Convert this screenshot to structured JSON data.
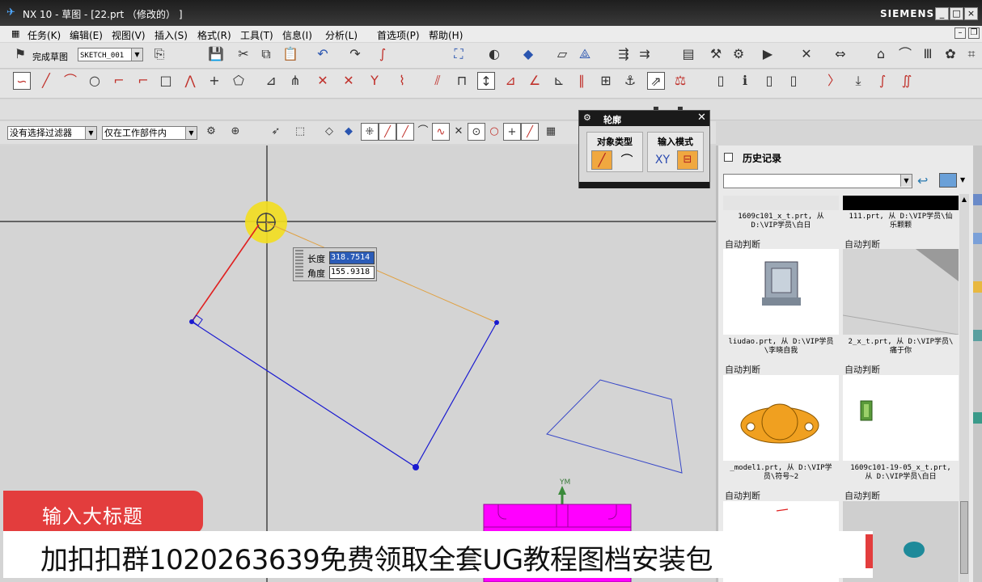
{
  "window": {
    "title": "NX 10 - 草图 - [22.prt （修改的） ]",
    "brand": "SIEMENS",
    "controls": [
      "_",
      "□",
      "×"
    ]
  },
  "menu": [
    "任务(K)",
    "编辑(E)",
    "视图(V)",
    "插入(S)",
    "格式(R)",
    "工具(T)",
    "信息(I)",
    "分析(L)",
    "首选项(P)",
    "帮助(H)"
  ],
  "sketch": {
    "finish_label": "完成草图",
    "name_value": "SKETCH_001"
  },
  "filter": {
    "selection_filter": "没有选择过滤器",
    "scope": "仅在工作部件内"
  },
  "dynamic_input": {
    "length_label": "长度",
    "length_value": "318.7514",
    "angle_label": "角度",
    "angle_value": "155.9318"
  },
  "profile_dialog": {
    "title": "轮廓",
    "object_type_label": "对象类型",
    "input_mode_label": "输入模式",
    "xy_label": "XY"
  },
  "history": {
    "title": "历史记录",
    "auto_label": "自动判断",
    "items": [
      {
        "caption_top": "1609c101_x_t.prt, 从",
        "caption_bottom": "D:\\VIP学员\\白日"
      },
      {
        "caption_top": "111.prt, 从 D:\\VIP学员\\仙",
        "caption_bottom": "乐颗颗"
      },
      {
        "caption_top": "liudao.prt, 从 D:\\VIP学员",
        "caption_bottom": "\\李晓自我"
      },
      {
        "caption_top": "2_x_t.prt, 从 D:\\VIP学员\\",
        "caption_bottom": "痛于你"
      },
      {
        "caption_top": "_model1.prt, 从 D:\\VIP学",
        "caption_bottom": "员\\符号~2"
      },
      {
        "caption_top": "1609c101-19-05_x_t.prt,",
        "caption_bottom": "从 D:\\VIP学员\\白日"
      }
    ]
  },
  "axis_label": "YM",
  "banner": {
    "title": "输入大标题",
    "subtitle": "加扣扣群1020263639免费领取全套UG教程图档安装包"
  },
  "colors": {
    "sketch_line": "#1a1ad0",
    "active_line": "#e02020",
    "rubber_band": "#e0a040",
    "part_magenta": "#ff00ff",
    "banner_red": "#e33d3d"
  }
}
